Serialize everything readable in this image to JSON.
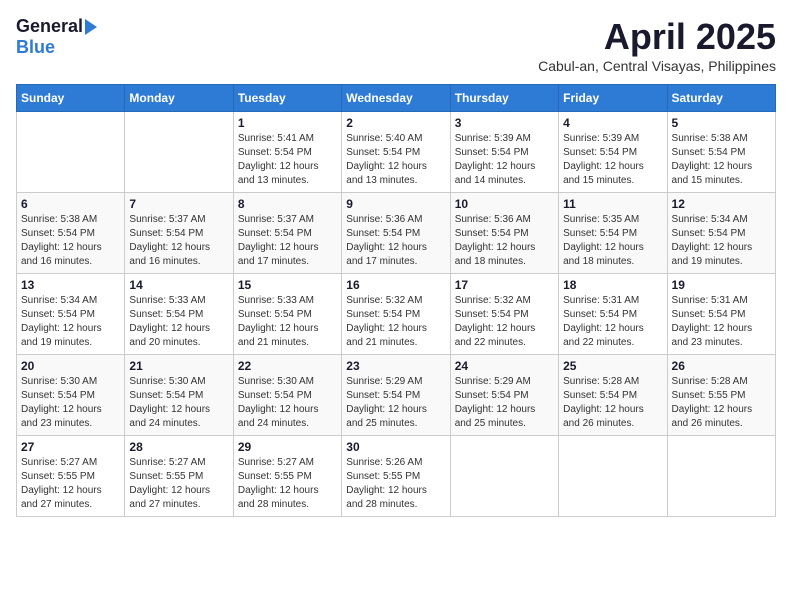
{
  "header": {
    "logo_general": "General",
    "logo_blue": "Blue",
    "title": "April 2025",
    "location": "Cabul-an, Central Visayas, Philippines"
  },
  "days_of_week": [
    "Sunday",
    "Monday",
    "Tuesday",
    "Wednesday",
    "Thursday",
    "Friday",
    "Saturday"
  ],
  "weeks": [
    [
      {
        "day": "",
        "sunrise": "",
        "sunset": "",
        "daylight": ""
      },
      {
        "day": "",
        "sunrise": "",
        "sunset": "",
        "daylight": ""
      },
      {
        "day": "1",
        "sunrise": "Sunrise: 5:41 AM",
        "sunset": "Sunset: 5:54 PM",
        "daylight": "Daylight: 12 hours and 13 minutes."
      },
      {
        "day": "2",
        "sunrise": "Sunrise: 5:40 AM",
        "sunset": "Sunset: 5:54 PM",
        "daylight": "Daylight: 12 hours and 13 minutes."
      },
      {
        "day": "3",
        "sunrise": "Sunrise: 5:39 AM",
        "sunset": "Sunset: 5:54 PM",
        "daylight": "Daylight: 12 hours and 14 minutes."
      },
      {
        "day": "4",
        "sunrise": "Sunrise: 5:39 AM",
        "sunset": "Sunset: 5:54 PM",
        "daylight": "Daylight: 12 hours and 15 minutes."
      },
      {
        "day": "5",
        "sunrise": "Sunrise: 5:38 AM",
        "sunset": "Sunset: 5:54 PM",
        "daylight": "Daylight: 12 hours and 15 minutes."
      }
    ],
    [
      {
        "day": "6",
        "sunrise": "Sunrise: 5:38 AM",
        "sunset": "Sunset: 5:54 PM",
        "daylight": "Daylight: 12 hours and 16 minutes."
      },
      {
        "day": "7",
        "sunrise": "Sunrise: 5:37 AM",
        "sunset": "Sunset: 5:54 PM",
        "daylight": "Daylight: 12 hours and 16 minutes."
      },
      {
        "day": "8",
        "sunrise": "Sunrise: 5:37 AM",
        "sunset": "Sunset: 5:54 PM",
        "daylight": "Daylight: 12 hours and 17 minutes."
      },
      {
        "day": "9",
        "sunrise": "Sunrise: 5:36 AM",
        "sunset": "Sunset: 5:54 PM",
        "daylight": "Daylight: 12 hours and 17 minutes."
      },
      {
        "day": "10",
        "sunrise": "Sunrise: 5:36 AM",
        "sunset": "Sunset: 5:54 PM",
        "daylight": "Daylight: 12 hours and 18 minutes."
      },
      {
        "day": "11",
        "sunrise": "Sunrise: 5:35 AM",
        "sunset": "Sunset: 5:54 PM",
        "daylight": "Daylight: 12 hours and 18 minutes."
      },
      {
        "day": "12",
        "sunrise": "Sunrise: 5:34 AM",
        "sunset": "Sunset: 5:54 PM",
        "daylight": "Daylight: 12 hours and 19 minutes."
      }
    ],
    [
      {
        "day": "13",
        "sunrise": "Sunrise: 5:34 AM",
        "sunset": "Sunset: 5:54 PM",
        "daylight": "Daylight: 12 hours and 19 minutes."
      },
      {
        "day": "14",
        "sunrise": "Sunrise: 5:33 AM",
        "sunset": "Sunset: 5:54 PM",
        "daylight": "Daylight: 12 hours and 20 minutes."
      },
      {
        "day": "15",
        "sunrise": "Sunrise: 5:33 AM",
        "sunset": "Sunset: 5:54 PM",
        "daylight": "Daylight: 12 hours and 21 minutes."
      },
      {
        "day": "16",
        "sunrise": "Sunrise: 5:32 AM",
        "sunset": "Sunset: 5:54 PM",
        "daylight": "Daylight: 12 hours and 21 minutes."
      },
      {
        "day": "17",
        "sunrise": "Sunrise: 5:32 AM",
        "sunset": "Sunset: 5:54 PM",
        "daylight": "Daylight: 12 hours and 22 minutes."
      },
      {
        "day": "18",
        "sunrise": "Sunrise: 5:31 AM",
        "sunset": "Sunset: 5:54 PM",
        "daylight": "Daylight: 12 hours and 22 minutes."
      },
      {
        "day": "19",
        "sunrise": "Sunrise: 5:31 AM",
        "sunset": "Sunset: 5:54 PM",
        "daylight": "Daylight: 12 hours and 23 minutes."
      }
    ],
    [
      {
        "day": "20",
        "sunrise": "Sunrise: 5:30 AM",
        "sunset": "Sunset: 5:54 PM",
        "daylight": "Daylight: 12 hours and 23 minutes."
      },
      {
        "day": "21",
        "sunrise": "Sunrise: 5:30 AM",
        "sunset": "Sunset: 5:54 PM",
        "daylight": "Daylight: 12 hours and 24 minutes."
      },
      {
        "day": "22",
        "sunrise": "Sunrise: 5:30 AM",
        "sunset": "Sunset: 5:54 PM",
        "daylight": "Daylight: 12 hours and 24 minutes."
      },
      {
        "day": "23",
        "sunrise": "Sunrise: 5:29 AM",
        "sunset": "Sunset: 5:54 PM",
        "daylight": "Daylight: 12 hours and 25 minutes."
      },
      {
        "day": "24",
        "sunrise": "Sunrise: 5:29 AM",
        "sunset": "Sunset: 5:54 PM",
        "daylight": "Daylight: 12 hours and 25 minutes."
      },
      {
        "day": "25",
        "sunrise": "Sunrise: 5:28 AM",
        "sunset": "Sunset: 5:54 PM",
        "daylight": "Daylight: 12 hours and 26 minutes."
      },
      {
        "day": "26",
        "sunrise": "Sunrise: 5:28 AM",
        "sunset": "Sunset: 5:55 PM",
        "daylight": "Daylight: 12 hours and 26 minutes."
      }
    ],
    [
      {
        "day": "27",
        "sunrise": "Sunrise: 5:27 AM",
        "sunset": "Sunset: 5:55 PM",
        "daylight": "Daylight: 12 hours and 27 minutes."
      },
      {
        "day": "28",
        "sunrise": "Sunrise: 5:27 AM",
        "sunset": "Sunset: 5:55 PM",
        "daylight": "Daylight: 12 hours and 27 minutes."
      },
      {
        "day": "29",
        "sunrise": "Sunrise: 5:27 AM",
        "sunset": "Sunset: 5:55 PM",
        "daylight": "Daylight: 12 hours and 28 minutes."
      },
      {
        "day": "30",
        "sunrise": "Sunrise: 5:26 AM",
        "sunset": "Sunset: 5:55 PM",
        "daylight": "Daylight: 12 hours and 28 minutes."
      },
      {
        "day": "",
        "sunrise": "",
        "sunset": "",
        "daylight": ""
      },
      {
        "day": "",
        "sunrise": "",
        "sunset": "",
        "daylight": ""
      },
      {
        "day": "",
        "sunrise": "",
        "sunset": "",
        "daylight": ""
      }
    ]
  ]
}
